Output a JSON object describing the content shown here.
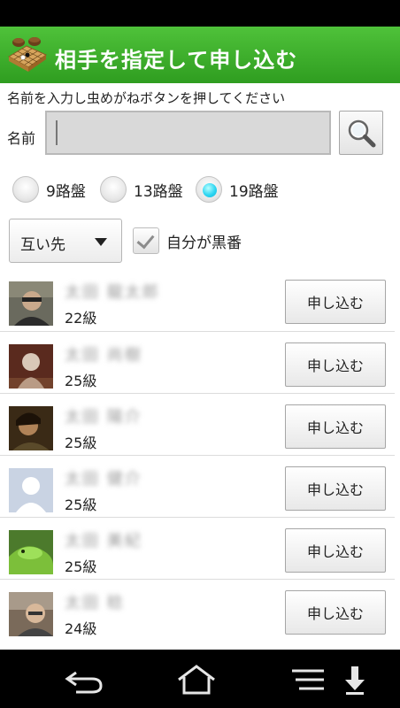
{
  "header": {
    "title": "相手を指定して申し込む"
  },
  "search": {
    "instruction": "名前を入力し虫めがねボタンを押してください",
    "name_label": "名前",
    "name_value": ""
  },
  "board_sizes": [
    {
      "label": "9路盤",
      "selected": false
    },
    {
      "label": "13路盤",
      "selected": false
    },
    {
      "label": "19路盤",
      "selected": true
    }
  ],
  "handicap": {
    "selected": "互い先"
  },
  "black_option": {
    "label": "自分が黒番",
    "checked": true
  },
  "players": [
    {
      "name": "太田 龍太郎",
      "rank": "22級",
      "button": "申し込む"
    },
    {
      "name": "太田 尚樹",
      "rank": "25級",
      "button": "申し込む"
    },
    {
      "name": "太田 陽介",
      "rank": "25級",
      "button": "申し込む"
    },
    {
      "name": "太田 健介",
      "rank": "25級",
      "button": "申し込む"
    },
    {
      "name": "太田 美紀",
      "rank": "25級",
      "button": "申し込む"
    },
    {
      "name": "太田 稔",
      "rank": "24級",
      "button": "申し込む"
    }
  ],
  "icons": {
    "app": "go-board-icon",
    "search": "magnifier-icon",
    "back": "back-icon",
    "home": "home-icon",
    "menu": "menu-icon",
    "download": "download-icon"
  },
  "colors": {
    "header": "#3aad2a",
    "radio_selected": "#22c8e8"
  }
}
